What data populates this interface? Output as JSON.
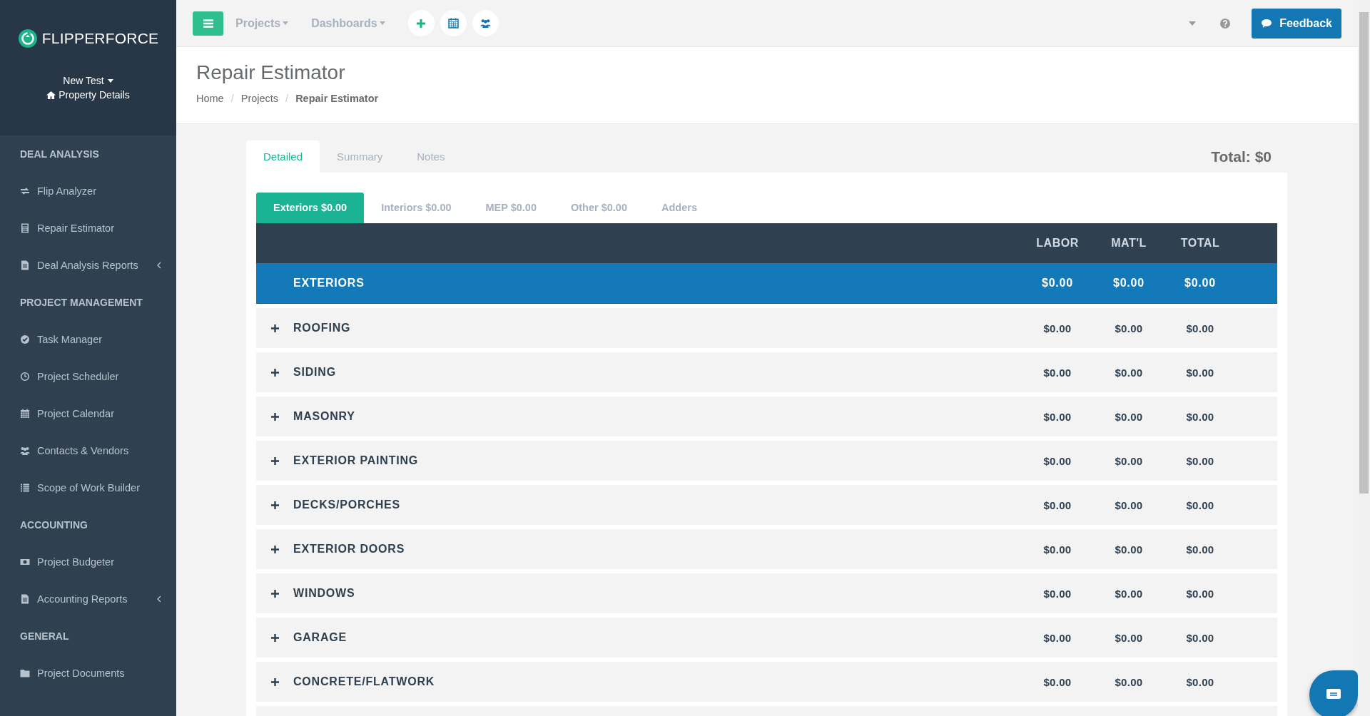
{
  "sidebar": {
    "logo": "FLIPPERFORCE",
    "project": "New Test",
    "property_link": "Property Details",
    "sections": [
      {
        "title": "DEAL ANALYSIS",
        "items": [
          {
            "label": "Flip Analyzer",
            "submenu": false
          },
          {
            "label": "Repair Estimator",
            "submenu": false
          },
          {
            "label": "Deal Analysis Reports",
            "submenu": true
          }
        ]
      },
      {
        "title": "PROJECT MANAGEMENT",
        "items": [
          {
            "label": "Task Manager",
            "submenu": false
          },
          {
            "label": "Project Scheduler",
            "submenu": false
          },
          {
            "label": "Project Calendar",
            "submenu": false
          },
          {
            "label": "Contacts & Vendors",
            "submenu": false
          },
          {
            "label": "Scope of Work Builder",
            "submenu": false
          }
        ]
      },
      {
        "title": "ACCOUNTING",
        "items": [
          {
            "label": "Project Budgeter",
            "submenu": false
          },
          {
            "label": "Accounting Reports",
            "submenu": true
          }
        ]
      },
      {
        "title": "GENERAL",
        "items": [
          {
            "label": "Project Documents",
            "submenu": false
          }
        ]
      }
    ]
  },
  "topbar": {
    "menus": [
      "Projects",
      "Dashboards"
    ],
    "feedback": "Feedback"
  },
  "header": {
    "title": "Repair Estimator",
    "breadcrumbs": [
      "Home",
      "Projects",
      "Repair Estimator"
    ],
    "separators": [
      "/",
      "/"
    ]
  },
  "tabs": [
    {
      "label": "Detailed",
      "selected": true
    },
    {
      "label": "Summary",
      "selected": false
    },
    {
      "label": "Notes",
      "selected": false
    }
  ],
  "total": "Total: $0",
  "category_tabs": [
    {
      "label": "Exteriors $0.00",
      "selected": true
    },
    {
      "label": "Interiors $0.00",
      "selected": false
    },
    {
      "label": "MEP $0.00",
      "selected": false
    },
    {
      "label": "Other $0.00",
      "selected": false
    },
    {
      "label": "Adders",
      "selected": false
    }
  ],
  "table": {
    "columns": [
      "LABOR",
      "MAT'L",
      "TOTAL"
    ],
    "group": {
      "name": "EXTERIORS",
      "labor": "$0.00",
      "material": "$0.00",
      "total": "$0.00"
    },
    "rows": [
      {
        "name": "ROOFING",
        "labor": "$0.00",
        "material": "$0.00",
        "total": "$0.00"
      },
      {
        "name": "SIDING",
        "labor": "$0.00",
        "material": "$0.00",
        "total": "$0.00"
      },
      {
        "name": "MASONRY",
        "labor": "$0.00",
        "material": "$0.00",
        "total": "$0.00"
      },
      {
        "name": "EXTERIOR PAINTING",
        "labor": "$0.00",
        "material": "$0.00",
        "total": "$0.00"
      },
      {
        "name": "DECKS/PORCHES",
        "labor": "$0.00",
        "material": "$0.00",
        "total": "$0.00"
      },
      {
        "name": "EXTERIOR DOORS",
        "labor": "$0.00",
        "material": "$0.00",
        "total": "$0.00"
      },
      {
        "name": "WINDOWS",
        "labor": "$0.00",
        "material": "$0.00",
        "total": "$0.00"
      },
      {
        "name": "GARAGE",
        "labor": "$0.00",
        "material": "$0.00",
        "total": "$0.00"
      },
      {
        "name": "CONCRETE/FLATWORK",
        "labor": "$0.00",
        "material": "$0.00",
        "total": "$0.00"
      }
    ]
  }
}
